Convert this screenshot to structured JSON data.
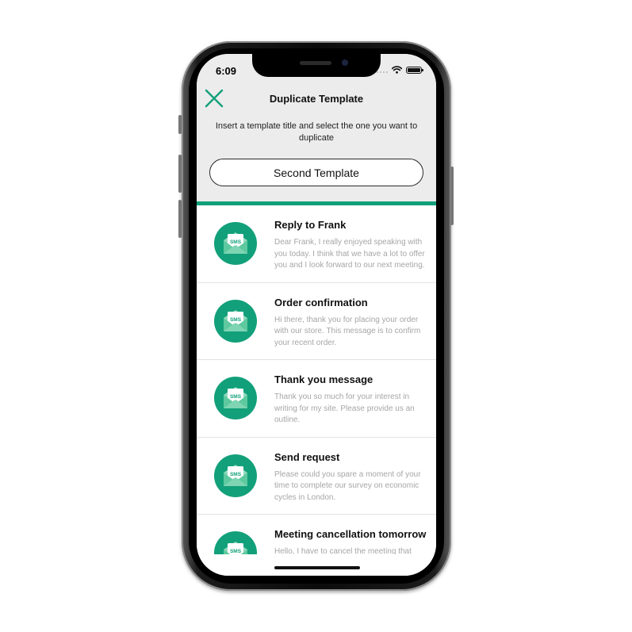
{
  "status_bar": {
    "time": "6:09"
  },
  "header": {
    "title": "Duplicate Template",
    "subtitle": "Insert a template title and select the one you want to duplicate",
    "input_value": "Second Template"
  },
  "colors": {
    "accent": "#12a07a",
    "header_bg": "#ececec"
  },
  "icons": {
    "close": "close-icon",
    "template": "sms-envelope-icon",
    "icon_label": "SMS"
  },
  "templates": [
    {
      "title": "Reply to Frank",
      "body": "Dear Frank, I really enjoyed speaking with you today. I think that we have a lot to offer you and I look forward to our next meeting."
    },
    {
      "title": "Order confirmation",
      "body": "Hi there, thank you for placing your order with our store. This message is to confirm your recent order."
    },
    {
      "title": "Thank you message",
      "body": "Thank you so much for your interest in writing for my site. Please provide us an outline."
    },
    {
      "title": "Send request",
      "body": "Please could you spare a moment of your time to complete our survey on economic cycles in London."
    },
    {
      "title": "Meeting cancellation tomorrow",
      "body": "Hello, I have to cancel the meeting that"
    }
  ]
}
